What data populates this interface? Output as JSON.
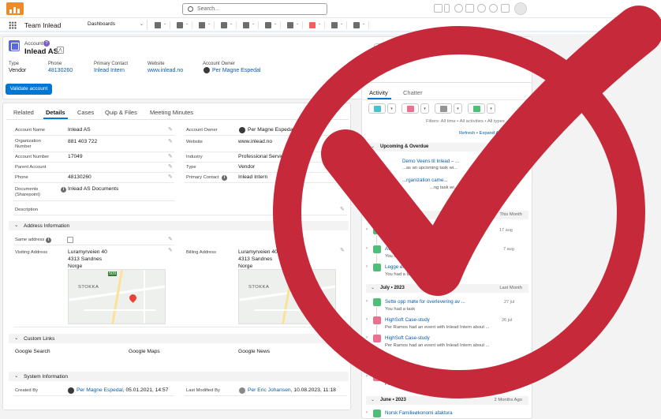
{
  "header": {
    "search_placeholder": "Search...",
    "app_name": "Team Inlead",
    "nav_dropdown": "Dashboards"
  },
  "record": {
    "object_label": "Account",
    "name": "Inlead AS",
    "highlights": [
      {
        "label": "Type",
        "value": "Vendor",
        "is_link": false
      },
      {
        "label": "Phone",
        "value": "48130260",
        "is_link": true
      },
      {
        "label": "Primary Contact",
        "value": "Inlead Intern",
        "is_link": true
      },
      {
        "label": "Website",
        "value": "www.inlead.no",
        "is_link": true
      },
      {
        "label": "Account Owner",
        "value": "Per Magne Espedal",
        "is_link": true
      }
    ],
    "validate_button": "Validate account"
  },
  "tabs": [
    "Related",
    "Details",
    "Cases",
    "Quip & Files",
    "Meeting Minutes"
  ],
  "fields": {
    "account_name": {
      "label": "Account Name",
      "value": "Inlead AS"
    },
    "org_number": {
      "label": "Organization Number",
      "value": "881 403 722"
    },
    "account_number": {
      "label": "Account Number",
      "value": "17049"
    },
    "parent_account": {
      "label": "Parent Account",
      "value": ""
    },
    "phone": {
      "label": "Phone",
      "value": "48130260"
    },
    "documents": {
      "label": "Documents (Sharepoint)",
      "value": "Inlead AS Documents"
    },
    "description": {
      "label": "Description",
      "value": ""
    },
    "account_owner": {
      "label": "Account Owner",
      "value": "Per Magne Espedal"
    },
    "website": {
      "label": "Website",
      "value": "www.inlead.no"
    },
    "industry": {
      "label": "Industry",
      "value": "Professional Services"
    },
    "type": {
      "label": "Type",
      "value": "Vendor"
    },
    "primary_contact": {
      "label": "Primary Contact",
      "value": "Inlead Intern"
    }
  },
  "address": {
    "section_title": "Address Information",
    "same_address_label": "Same address",
    "visiting_label": "Visiting Address",
    "visiting_lines": [
      "Luramyrveien 40",
      "4313 Sandnes",
      "Norge"
    ],
    "billing_label": "Billing Address",
    "billing_lines": [
      "Luramyrveien 40",
      "4313 Sandnes",
      "Norge"
    ],
    "map_label": "STOKKA",
    "map_road_label": "509"
  },
  "custom_links": {
    "section_title": "Custom Links",
    "links": [
      "Google Search",
      "Google Maps",
      "Google News"
    ]
  },
  "system": {
    "section_title": "System Information",
    "created_by_label": "Created By",
    "created_by": "Per Magne Espedal",
    "created_date": ", 05.01.2021, 14:57",
    "modified_label": "Last Modified By",
    "modified_by": "Per Eric Johansen",
    "modified_date": ", 10.08.2023, 11:18"
  },
  "activity": {
    "tabs": [
      "Activity",
      "Chatter"
    ],
    "filters": "Filters: All time • All activities • All types",
    "refresh": "Refresh • Expand All • View All",
    "upcoming": {
      "title": "Upcoming & Overdue",
      "items": [
        {
          "subject": "Demo Veens til Inlead – ...",
          "desc": "...as an upcoming task wi..."
        },
        {
          "subject": "...rganization came...",
          "desc": "...ng task wi..."
        }
      ]
    },
    "groups": [
      {
        "title": "August • 2023",
        "right": "This Month",
        "items": [
          {
            "subject": "Anders ...",
            "desc": "Anders M...",
            "date": "17 aug",
            "color": "#4bc076"
          },
          {
            "subject": "Avstemme d...",
            "desc": "You had a task",
            "date": "7 aug",
            "color": "#4bc076"
          },
          {
            "subject": "Legge en plan på ...",
            "desc": "You had a task",
            "date": "",
            "color": "#4bc076"
          }
        ]
      },
      {
        "title": "July • 2023",
        "right": "Last Month",
        "items": [
          {
            "subject": "Sette opp møte for overlevering av ...",
            "desc": "You had a task",
            "date": "27 jul",
            "color": "#4bc076"
          },
          {
            "subject": "HighSoft Case-study",
            "desc": "Per Ramos  had an event with  Inlead Intern  about  ...",
            "date": "26 jul",
            "color": "#eb7092"
          },
          {
            "subject": "HighSoft Case-study",
            "desc": "Per Ramos  had an event with  Inlead Intern  about  ...",
            "date": "",
            "color": "#eb7092"
          },
          {
            "subject": "HighSoft ...",
            "desc": "Per Ramos  had an event with  Inlead Intern  about  ...",
            "date": "",
            "color": "#eb7092"
          }
        ]
      },
      {
        "title": "June • 2023",
        "right": "2 Months Ago",
        "items": [
          {
            "subject": "Norsk Familieøkonomi afaktura",
            "desc": "",
            "date": "",
            "color": "#4bc076"
          }
        ]
      }
    ]
  },
  "colors": {
    "brand": "#0176d3",
    "check_red": "#c62a3a",
    "account_icon": "#5867e8"
  }
}
